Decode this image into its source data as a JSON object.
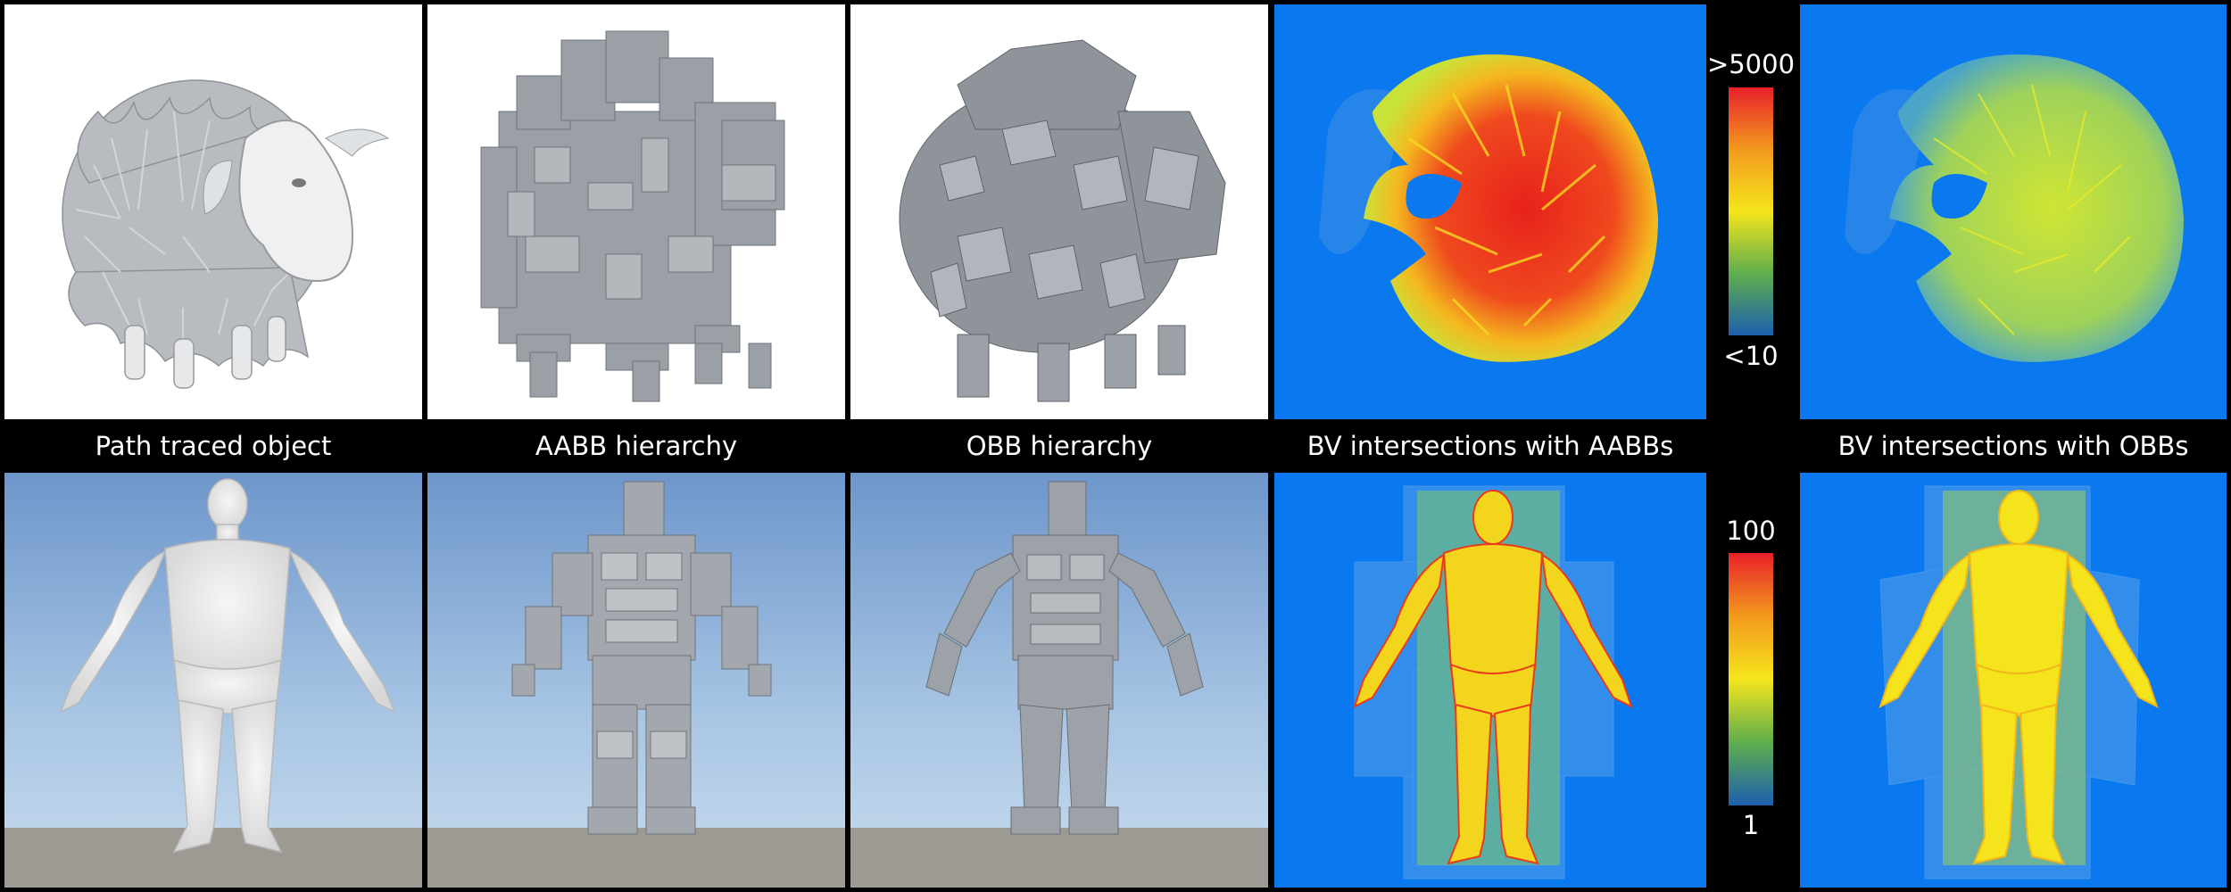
{
  "columns": {
    "path_traced": "Path traced object",
    "aabb": "AABB hierarchy",
    "obb": "OBB hierarchy",
    "bv_aabb": "BV intersections with AABBs",
    "bv_obb": "BV intersections with OBBs"
  },
  "colorbars": {
    "top": {
      "max": ">5000",
      "min": "<10"
    },
    "bottom": {
      "max": "100",
      "min": "1"
    }
  },
  "colors": {
    "heatmap_background": "#0a78ee",
    "sky": "#8fb3db",
    "ground": "#9c9a93",
    "model_gray": "#a9adb2"
  }
}
